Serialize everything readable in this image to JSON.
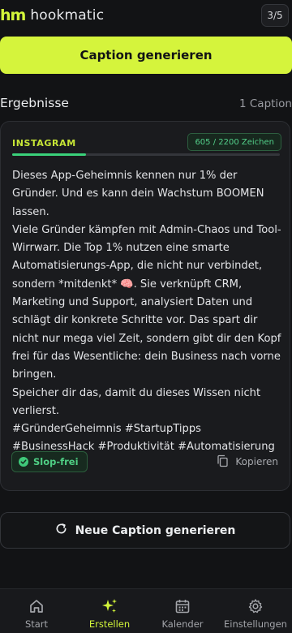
{
  "app": {
    "logo_mark": "hm",
    "name": "hookmatic",
    "step": "3/5"
  },
  "actions": {
    "generate_label": "Caption generieren",
    "regenerate_label": "Neue Caption generieren"
  },
  "results": {
    "title": "Ergebnisse",
    "count": "1 Caption"
  },
  "card": {
    "platform": "INSTAGRAM",
    "char_count": "605 / 2200 Zeichen",
    "progress_fraction": 0.275,
    "caption": "Dieses App-Geheimnis kennen nur 1% der Gründer. Und es kann dein Wachstum BOOMEN lassen.\nViele Gründer kämpfen mit Admin-Chaos und Tool-Wirrwarr. Die Top 1% nutzen eine smarte Automatisierungs-App, die nicht nur verbindet, sondern *mitdenkt* 🧠. Sie verknüpft CRM, Marketing und Support, analysiert Daten und schlägt dir konkrete Schritte vor. Das spart dir nicht nur mega viel Zeit, sondern gibt dir den Kopf frei für das Wesentliche: dein Business nach vorne bringen.\nSpeicher dir das, damit du dieses Wissen nicht verlierst.\n#GründerGeheimnis #StartupTipps #BusinessHack #Produktivität #Automatisierung",
    "slop_label": "Slop-frei",
    "copy_label": "Kopieren"
  },
  "nav": {
    "items": [
      {
        "label": "Start",
        "icon": "home-icon"
      },
      {
        "label": "Erstellen",
        "icon": "sparkles-icon"
      },
      {
        "label": "Kalender",
        "icon": "calendar-icon"
      },
      {
        "label": "Einstellungen",
        "icon": "gear-icon"
      }
    ],
    "active_index": 1
  },
  "colors": {
    "accent": "#d5f43c",
    "success": "#3ad17a",
    "background": "#121315"
  }
}
